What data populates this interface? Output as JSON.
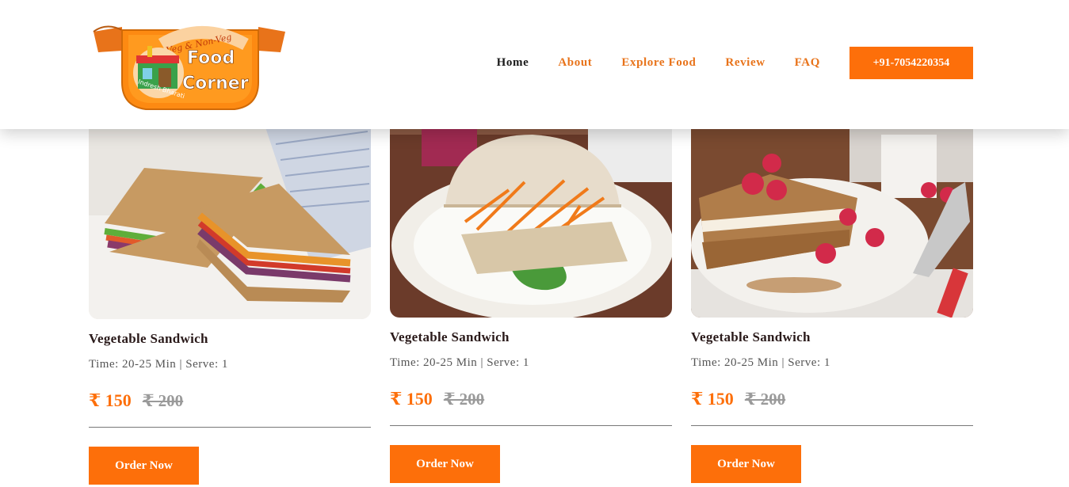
{
  "brand": {
    "logo_top_text": "Veg & Non-Veg",
    "logo_line1": "Food",
    "logo_line2": "Corner",
    "logo_sub": "Indresh Bharati",
    "colors": {
      "accent": "#fd6f0a",
      "nav_link": "#e8731a",
      "text_dark": "#1a1a1a"
    }
  },
  "nav": {
    "items": [
      {
        "label": "Home",
        "active": true
      },
      {
        "label": "About",
        "active": false
      },
      {
        "label": "Explore Food",
        "active": false
      },
      {
        "label": "Review",
        "active": false
      },
      {
        "label": "FAQ",
        "active": false
      }
    ],
    "phone_label": "+91-7054220354"
  },
  "cards": [
    {
      "title": "Vegetable Sandwich",
      "meta": "Time: 20-25 Min | Serve: 1",
      "price": "₹ 150",
      "old_price": "₹ 200",
      "button": "Order Now",
      "image": "sandwich-photo"
    },
    {
      "title": "Vegetable Sandwich",
      "meta": "Time: 20-25 Min | Serve: 1",
      "price": "₹ 150",
      "old_price": "₹ 200",
      "button": "Order Now",
      "image": "ciabatta-photo"
    },
    {
      "title": "Vegetable Sandwich",
      "meta": "Time: 20-25 Min | Serve: 1",
      "price": "₹ 150",
      "old_price": "₹ 200",
      "button": "Order Now",
      "image": "french-toast-photo"
    }
  ]
}
